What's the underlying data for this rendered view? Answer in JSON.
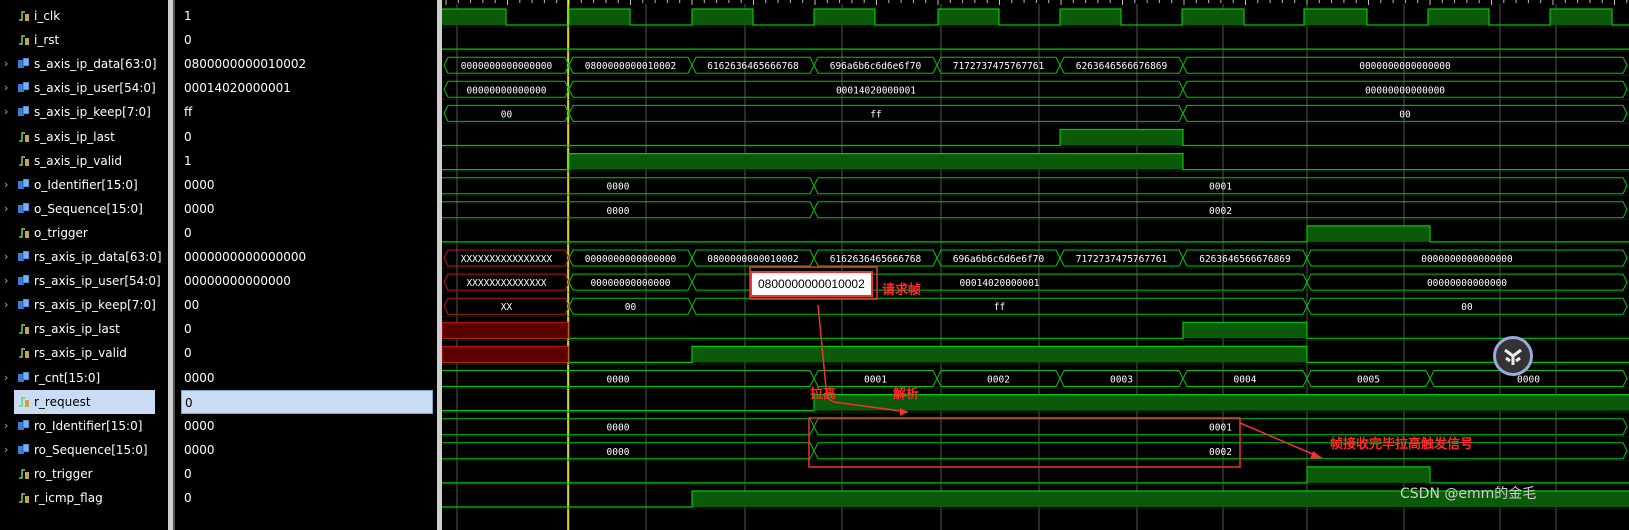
{
  "signals": [
    {
      "name": "i_clk",
      "value": "1",
      "kind": "bit",
      "expandable": false
    },
    {
      "name": "i_rst",
      "value": "0",
      "kind": "bit",
      "expandable": false
    },
    {
      "name": "s_axis_ip_data[63:0]",
      "value": "0800000000010002",
      "kind": "bus",
      "expandable": true
    },
    {
      "name": "s_axis_ip_user[54:0]",
      "value": "00014020000001",
      "kind": "bus",
      "expandable": true
    },
    {
      "name": "s_axis_ip_keep[7:0]",
      "value": "ff",
      "kind": "bus",
      "expandable": true
    },
    {
      "name": "s_axis_ip_last",
      "value": "0",
      "kind": "bit",
      "expandable": false
    },
    {
      "name": "s_axis_ip_valid",
      "value": "1",
      "kind": "bit",
      "expandable": false
    },
    {
      "name": "o_Identifier[15:0]",
      "value": "0000",
      "kind": "bus",
      "expandable": true
    },
    {
      "name": "o_Sequence[15:0]",
      "value": "0000",
      "kind": "bus",
      "expandable": true
    },
    {
      "name": "o_trigger",
      "value": "0",
      "kind": "bit",
      "expandable": false
    },
    {
      "name": "rs_axis_ip_data[63:0]",
      "value": "0000000000000000",
      "kind": "bus",
      "expandable": true
    },
    {
      "name": "rs_axis_ip_user[54:0]",
      "value": "00000000000000",
      "kind": "bus",
      "expandable": true
    },
    {
      "name": "rs_axis_ip_keep[7:0]",
      "value": "00",
      "kind": "bus",
      "expandable": true
    },
    {
      "name": "rs_axis_ip_last",
      "value": "0",
      "kind": "bit",
      "expandable": false
    },
    {
      "name": "rs_axis_ip_valid",
      "value": "0",
      "kind": "bit",
      "expandable": false
    },
    {
      "name": "r_cnt[15:0]",
      "value": "0000",
      "kind": "bus",
      "expandable": true
    },
    {
      "name": "r_request",
      "value": "0",
      "kind": "bit",
      "expandable": false,
      "selected": true
    },
    {
      "name": "ro_Identifier[15:0]",
      "value": "0000",
      "kind": "bus",
      "expandable": true
    },
    {
      "name": "ro_Sequence[15:0]",
      "value": "0000",
      "kind": "bus",
      "expandable": true
    },
    {
      "name": "ro_trigger",
      "value": "0",
      "kind": "bit",
      "expandable": false
    },
    {
      "name": "r_icmp_flag",
      "value": "0",
      "kind": "bit",
      "expandable": false
    }
  ],
  "bus_segments": {
    "s_axis_ip_data[63:0]": [
      "0000000000000000",
      "0800000000010002",
      "6162636465666768",
      "696a6b6c6d6e6f70",
      "7172737475767761",
      "6263646566676869",
      "0000000000000000"
    ],
    "s_axis_ip_user[54:0]": [
      "00000000000000",
      "00014020000001",
      "00000000000000"
    ],
    "s_axis_ip_keep[7:0]": [
      "00",
      "ff",
      "00"
    ],
    "o_Identifier[15:0]": [
      "0000",
      "0001"
    ],
    "o_Sequence[15:0]": [
      "0000",
      "0002"
    ],
    "rs_axis_ip_data[63:0]": [
      "XXXXXXXXXXXXXXXX",
      "0000000000000000",
      "0800000000010002",
      "6162636465666768",
      "696a6b6c6d6e6f70",
      "7172737475767761",
      "6263646566676869",
      "0000000000000000"
    ],
    "rs_axis_ip_user[54:0]": [
      "XXXXXXXXXXXXXX",
      "00000000000000",
      "00014020000001",
      "00000000000000"
    ],
    "rs_axis_ip_keep[7:0]": [
      "XX",
      "00",
      "ff",
      "00"
    ],
    "r_cnt[15:0]": [
      "0000",
      "0001",
      "0002",
      "0003",
      "0004",
      "0005",
      "0000"
    ],
    "ro_Identifier[15:0]": [
      "0000",
      "0001"
    ],
    "ro_Sequence[15:0]": [
      "0000",
      "0002"
    ]
  },
  "annotations": {
    "callout_value": "0800000000010002",
    "request_frame": "请求帧",
    "pull_high": "拉高",
    "parse": "解析",
    "frame_done": "帧接收完毕拉高触发信号"
  },
  "watermark": "CSDN @emm的金毛",
  "colors": {
    "wave_green": "#00c800",
    "wave_fill": "#0a5a0a",
    "cursor": "#ffff00",
    "grid": "#8a8a8a",
    "undefined_red": "#cc1010",
    "annotation_red": "#ff2a2a",
    "selection": "#c9dcf3"
  }
}
